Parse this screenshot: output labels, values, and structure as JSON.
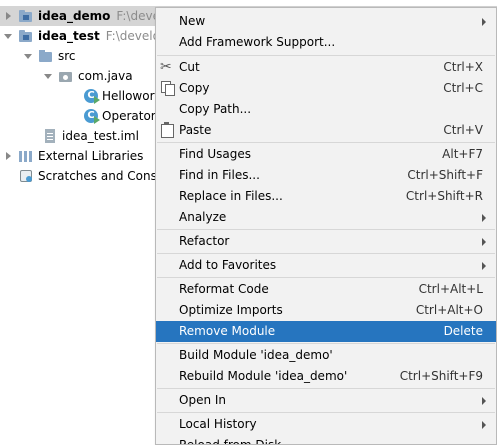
{
  "tree": {
    "idea_demo": {
      "name": "idea_demo",
      "path": "F:\\develo"
    },
    "idea_test": {
      "name": "idea_test",
      "path": "F:\\develo"
    },
    "src": "src",
    "package": "com.java",
    "classes": [
      "Hellowor",
      "Operator"
    ],
    "iml": "idea_test.iml",
    "external_libraries": "External Libraries",
    "scratches": "Scratches and Cons"
  },
  "menu": {
    "items": [
      {
        "label": "New",
        "shortcut": "",
        "submenu": true
      },
      {
        "label": "Add Framework Support...",
        "shortcut": ""
      },
      {
        "label": "Cut",
        "shortcut": "Ctrl+X",
        "icon": "cut-icon"
      },
      {
        "label": "Copy",
        "shortcut": "Ctrl+C",
        "icon": "copy-icon"
      },
      {
        "label": "Copy Path...",
        "shortcut": ""
      },
      {
        "label": "Paste",
        "shortcut": "Ctrl+V",
        "icon": "paste-icon"
      },
      {
        "label": "Find Usages",
        "shortcut": "Alt+F7"
      },
      {
        "label": "Find in Files...",
        "shortcut": "Ctrl+Shift+F"
      },
      {
        "label": "Replace in Files...",
        "shortcut": "Ctrl+Shift+R"
      },
      {
        "label": "Analyze",
        "shortcut": "",
        "submenu": true
      },
      {
        "label": "Refactor",
        "shortcut": "",
        "submenu": true
      },
      {
        "label": "Add to Favorites",
        "shortcut": "",
        "submenu": true
      },
      {
        "label": "Reformat Code",
        "shortcut": "Ctrl+Alt+L"
      },
      {
        "label": "Optimize Imports",
        "shortcut": "Ctrl+Alt+O"
      },
      {
        "label": "Remove Module",
        "shortcut": "Delete",
        "highlighted": true
      },
      {
        "label": "Build Module 'idea_demo'",
        "shortcut": ""
      },
      {
        "label": "Rebuild Module 'idea_demo'",
        "shortcut": "Ctrl+Shift+F9"
      },
      {
        "label": "Open In",
        "shortcut": "",
        "submenu": true
      },
      {
        "label": "Local History",
        "shortcut": "",
        "submenu": true
      },
      {
        "label": "Reload from Disk",
        "shortcut": ""
      }
    ]
  },
  "colors": {
    "highlight": "#2675bf",
    "menu_bg": "#f2f2f2"
  }
}
